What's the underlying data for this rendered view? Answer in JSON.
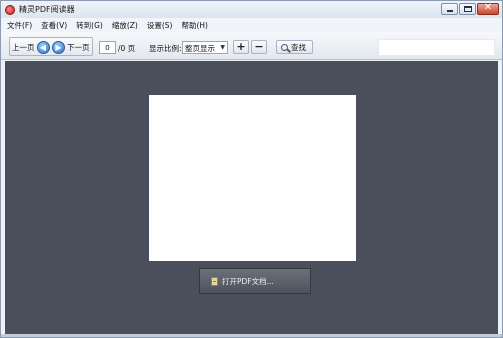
{
  "window": {
    "title": "精灵PDF阅读器",
    "controls": {
      "minimize": "minimize",
      "maximize": "maximize",
      "close": "✕"
    }
  },
  "menu": {
    "items": [
      "文件(F)",
      "查看(V)",
      "转到(G)",
      "缩放(Z)",
      "设置(S)",
      "帮助(H)"
    ]
  },
  "toolbar": {
    "prev_label": "上一页",
    "next_label": "下一页",
    "prev_arrow": "◀",
    "next_arrow": "▶",
    "page_value": "0",
    "page_total": "/0 页",
    "zoom_label": "显示比例:",
    "zoom_value": "整页显示",
    "zoom_chevron": "▼",
    "zoom_in": "+",
    "zoom_out": "−",
    "find_label": "查找",
    "search_value": ""
  },
  "viewer": {
    "open_label": "打开PDF文档..."
  },
  "colors": {
    "viewer_bg": "#4a4f5b",
    "accent": "#2c6fcc",
    "close_red": "#c9452f"
  },
  "icons": [
    "app-icon",
    "minimize-icon",
    "maximize-icon",
    "close-icon",
    "arrow-left-icon",
    "arrow-right-icon",
    "chevron-down-icon",
    "search-icon",
    "folder-icon"
  ]
}
